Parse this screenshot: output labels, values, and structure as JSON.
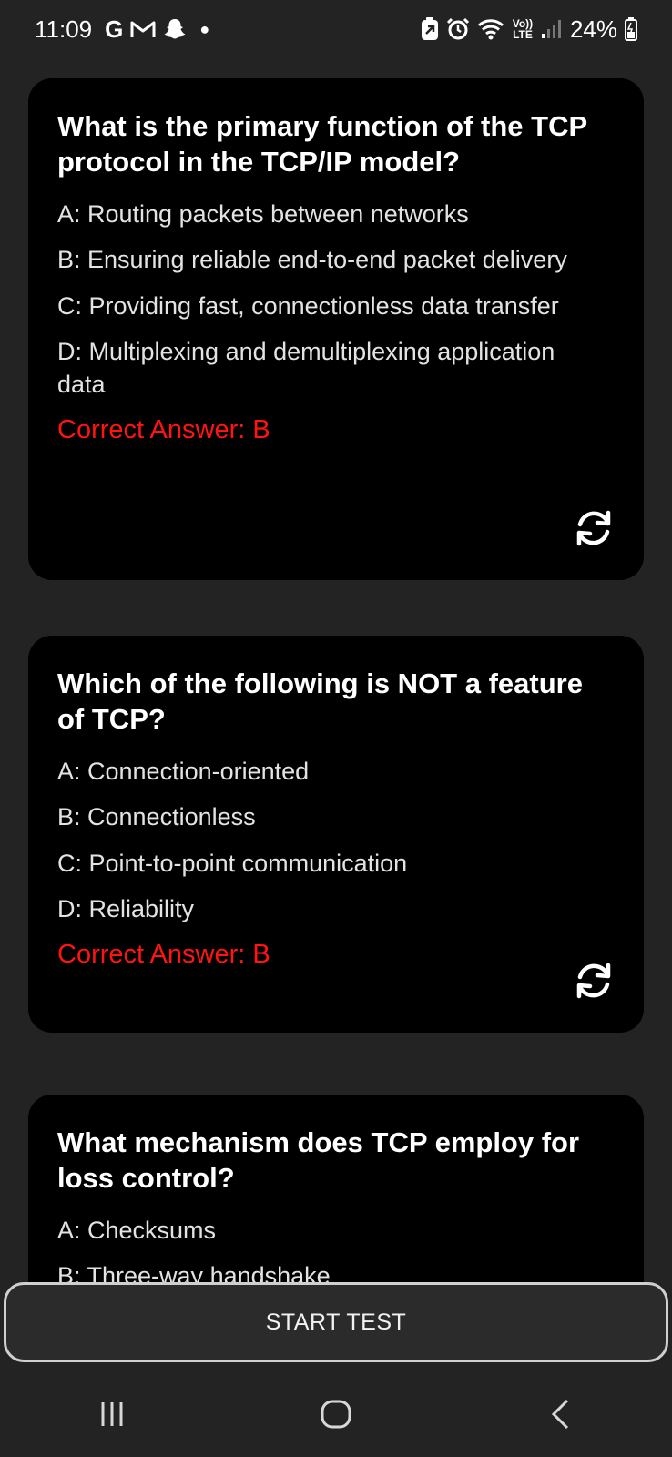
{
  "status_bar": {
    "time": "11:09",
    "notification_g": "G",
    "battery_percent": "24%",
    "signal_label": "Vo)) LTE",
    "icons": [
      "gmail-icon",
      "snapchat-icon",
      "dot-icon",
      "battery-saver-icon",
      "alarm-icon",
      "wifi-icon",
      "signal-icon",
      "battery-icon"
    ]
  },
  "cards": [
    {
      "question": "What is the primary function of the TCP protocol in the TCP/IP model?",
      "options": [
        "A: Routing packets between networks",
        "B: Ensuring reliable end-to-end packet delivery",
        "C: Providing fast, connectionless data transfer",
        "D: Multiplexing and demultiplexing application data"
      ],
      "answer": "Correct Answer: B",
      "action_icon": "refresh-icon"
    },
    {
      "question": "Which of the following is NOT a feature of TCP?",
      "options": [
        "A: Connection-oriented",
        "B: Connectionless",
        "C: Point-to-point communication",
        "D: Reliability"
      ],
      "answer": "Correct Answer: B",
      "action_icon": "refresh-icon"
    },
    {
      "question": "What mechanism does TCP employ for loss control?",
      "options": [
        "A: Checksums",
        "B: Three-way handshake"
      ]
    }
  ],
  "start_button": {
    "label": "START TEST"
  },
  "nav_bar": {
    "icons": [
      "recent-apps-icon",
      "home-icon",
      "back-icon"
    ]
  }
}
